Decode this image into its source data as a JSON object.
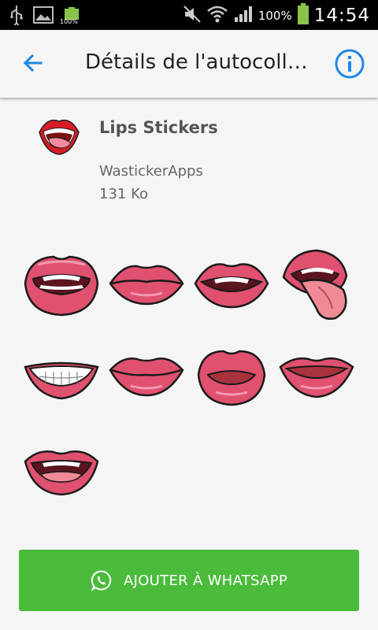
{
  "status_bar": {
    "battery_small_label": "100%",
    "battery_percent": "100%",
    "time": "14:54"
  },
  "app_bar": {
    "title": "Détails de l'autocoll…",
    "back_icon": "arrow-left",
    "info_icon": "info-circle",
    "accent_color": "#1e88e5"
  },
  "pack": {
    "name": "Lips Stickers",
    "publisher": "WastickerApps",
    "size": "131 Ko"
  },
  "stickers": [
    {
      "name": "open-mouth-teeth"
    },
    {
      "name": "closed-lips"
    },
    {
      "name": "parted-lips-teeth"
    },
    {
      "name": "tongue-out"
    },
    {
      "name": "smile-teeth"
    },
    {
      "name": "closed-lips-2"
    },
    {
      "name": "pout-lips"
    },
    {
      "name": "slim-lips"
    },
    {
      "name": "open-lips-tongue"
    }
  ],
  "action_button": {
    "label": "AJOUTER À WHATSAPP",
    "icon": "whatsapp-icon",
    "color": "#4bbb3c"
  }
}
